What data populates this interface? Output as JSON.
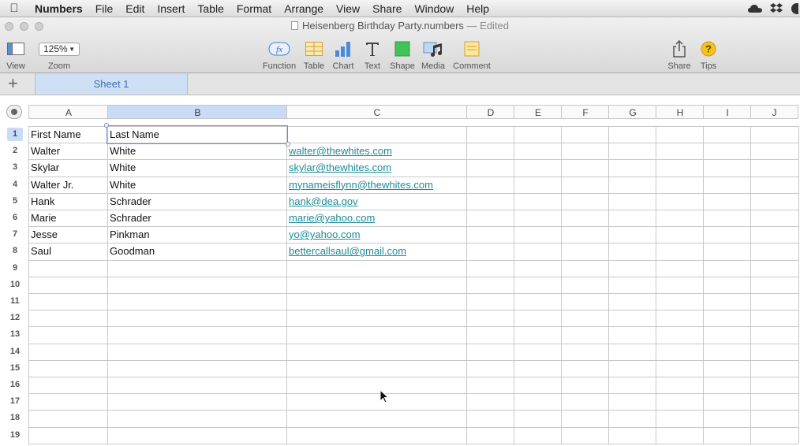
{
  "menubar": {
    "app_name": "Numbers",
    "items": [
      "File",
      "Edit",
      "Insert",
      "Table",
      "Format",
      "Arrange",
      "View",
      "Share",
      "Window",
      "Help"
    ]
  },
  "window": {
    "title": "Heisenberg Birthday Party.numbers",
    "status": "— Edited"
  },
  "toolbar": {
    "view_label": "View",
    "zoom_value": "125%",
    "zoom_label": "Zoom",
    "function_label": "Function",
    "table_label": "Table",
    "chart_label": "Chart",
    "text_label": "Text",
    "shape_label": "Shape",
    "media_label": "Media",
    "comment_label": "Comment",
    "share_label": "Share",
    "tips_label": "Tips",
    "function_icon_text": "fx",
    "tips_icon_text": "?"
  },
  "sheets": [
    {
      "label": "Sheet 1"
    }
  ],
  "colors": {
    "accent": "#3a6fb5",
    "link": "#1c8b97",
    "selection": "#c9dcf5"
  },
  "table": {
    "columns": [
      "A",
      "B",
      "C",
      "D",
      "E",
      "F",
      "G",
      "H",
      "I",
      "J"
    ],
    "row_numbers": [
      "1",
      "2",
      "3",
      "4",
      "5",
      "6",
      "7",
      "8",
      "9",
      "10",
      "11",
      "12",
      "13",
      "14",
      "15",
      "16",
      "17",
      "18",
      "19"
    ],
    "rows": [
      [
        "First Name",
        "Last Name",
        ""
      ],
      [
        "Walter",
        "White",
        "walter@thewhites.com"
      ],
      [
        "Skylar",
        "White",
        "skylar@thewhites.com"
      ],
      [
        "Walter Jr.",
        "White",
        "mynameisflynn@thewhites.com"
      ],
      [
        "Hank",
        "Schrader",
        "hank@dea.gov"
      ],
      [
        "Marie",
        "Schrader",
        "marie@yahoo.com"
      ],
      [
        "Jesse",
        "Pinkman",
        "yo@yahoo.com"
      ],
      [
        "Saul",
        "Goodman",
        "bettercallsaul@gmail.com"
      ]
    ]
  }
}
